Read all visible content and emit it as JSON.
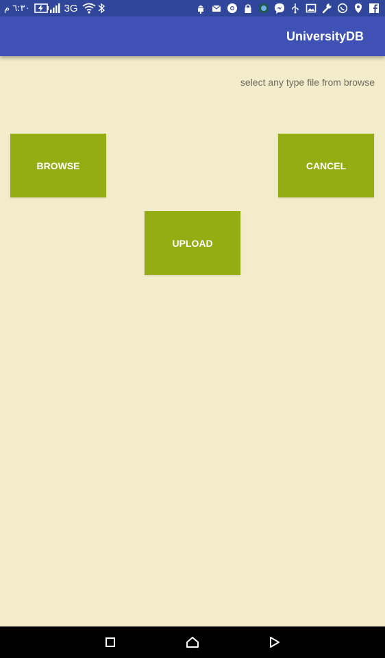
{
  "status_bar": {
    "time": "٦:٣٠ م",
    "network": "3G",
    "left_icons": [
      "battery-icon",
      "signal-icon",
      "wifi-icon",
      "bluetooth-icon"
    ],
    "right_icons": [
      "android-icon",
      "mail-icon",
      "chrome-icon",
      "lock-icon",
      "app-icon",
      "messenger-icon",
      "usb-icon",
      "image-icon",
      "wrench-icon",
      "whatsapp-icon",
      "location-icon",
      "facebook-icon"
    ]
  },
  "app_bar": {
    "title": "UniversityDB",
    "color": "#3f51b5"
  },
  "main": {
    "hint": "select any type file from browse",
    "background": "#f2ecca",
    "buttons": {
      "browse": "BROWSE",
      "cancel": "CANCEL",
      "upload": "UPLOAD"
    },
    "button_color": "#93ad12"
  },
  "nav_bar": {
    "icons": [
      "recents-icon",
      "home-icon",
      "back-icon"
    ]
  }
}
